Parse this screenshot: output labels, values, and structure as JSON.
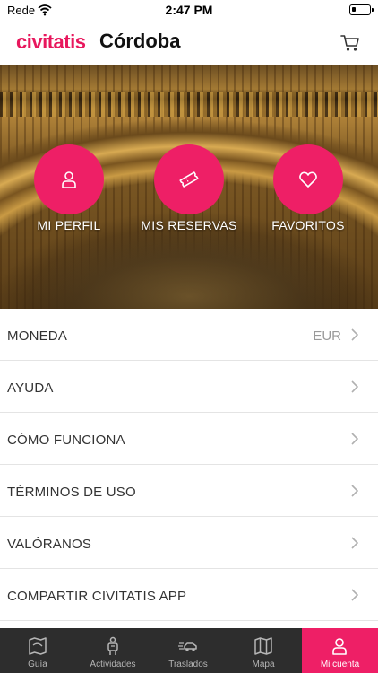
{
  "status_bar": {
    "carrier": "Rede",
    "time": "2:47 PM"
  },
  "header": {
    "brand": "civitatis",
    "city": "Córdoba",
    "cart_icon": "cart-icon"
  },
  "hero": {
    "buttons": [
      {
        "label": "MI PERFIL",
        "icon": "user-icon"
      },
      {
        "label": "MIS RESERVAS",
        "icon": "ticket-icon"
      },
      {
        "label": "FAVORITOS",
        "icon": "heart-icon"
      }
    ]
  },
  "menu": {
    "items": [
      {
        "label": "MONEDA",
        "value": "EUR"
      },
      {
        "label": "AYUDA"
      },
      {
        "label": "CÓMO FUNCIONA"
      },
      {
        "label": "TÉRMINOS DE USO"
      },
      {
        "label": "VALÓRANOS"
      },
      {
        "label": "COMPARTIR CIVITATIS APP"
      }
    ]
  },
  "tab_bar": {
    "tabs": [
      {
        "label": "Guía",
        "icon": "map-book-icon"
      },
      {
        "label": "Actividades",
        "icon": "hiker-icon"
      },
      {
        "label": "Traslados",
        "icon": "car-icon"
      },
      {
        "label": "Mapa",
        "icon": "map-icon"
      },
      {
        "label": "Mi cuenta",
        "icon": "user-icon",
        "active": true
      }
    ]
  },
  "colors": {
    "brand": "#e8175d",
    "hero_button": "#ee1f66",
    "tab_bar": "#2d2d2d"
  }
}
